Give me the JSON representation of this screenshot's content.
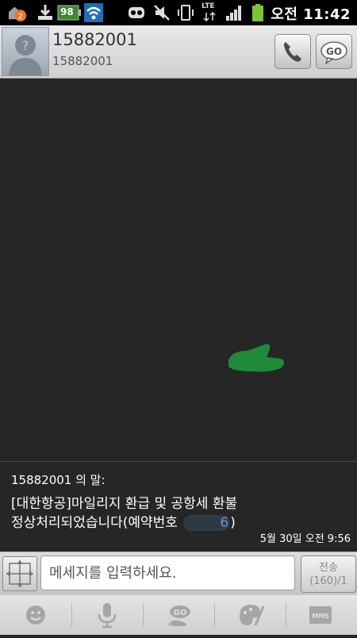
{
  "status_bar": {
    "battery_level": "98",
    "network": "LTE",
    "clock": "오전 11:42",
    "notification_badge": "2"
  },
  "contact": {
    "name": "15882001",
    "number": "15882001"
  },
  "message": {
    "sender": "15882001 의 말:",
    "line1": "[대한항공]마일리지 환급 및 공항세 환불",
    "line2_prefix": "정상처리되었습니다(예약번호 ",
    "ref_visible": "6",
    "line2_suffix": ")",
    "timestamp": "5월 30일 오전 9:56"
  },
  "compose": {
    "placeholder": "메세지를 입력하세요.",
    "send_label": "전송",
    "char_count": "(160)/1"
  },
  "toolbar": {
    "mms_label": "MMS"
  },
  "colors": {
    "background": "#262626",
    "doodle": "#1e8a3a",
    "link": "#6f8fc9"
  }
}
